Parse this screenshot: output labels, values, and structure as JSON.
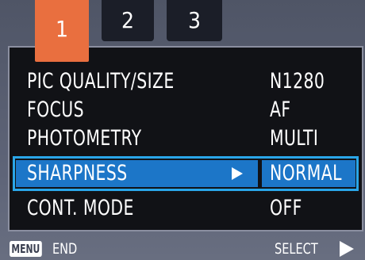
{
  "tabs": [
    {
      "label": "1",
      "active": true
    },
    {
      "label": "2",
      "active": false
    },
    {
      "label": "3",
      "active": false
    }
  ],
  "menu": {
    "items": [
      {
        "label": "PIC QUALITY/SIZE",
        "value": "N1280"
      },
      {
        "label": "FOCUS",
        "value": "AF"
      },
      {
        "label": "PHOTOMETRY",
        "value": "MULTI"
      },
      {
        "label": "SHARPNESS",
        "value": "NORMAL",
        "selected": true
      },
      {
        "label": "CONT. MODE",
        "value": "OFF"
      }
    ]
  },
  "footer": {
    "menu_key": "MENU",
    "end_label": "END",
    "select_label": "SELECT"
  },
  "colors": {
    "active_tab": "#e96f3f",
    "inactive_tab": "#1b1e28",
    "highlight": "#1c76c8",
    "highlight_frame": "#2aa6e8",
    "panel": "#111216"
  },
  "icons": {
    "submenu_indicator": "right-triangle-icon",
    "select_indicator": "right-triangle-icon"
  }
}
